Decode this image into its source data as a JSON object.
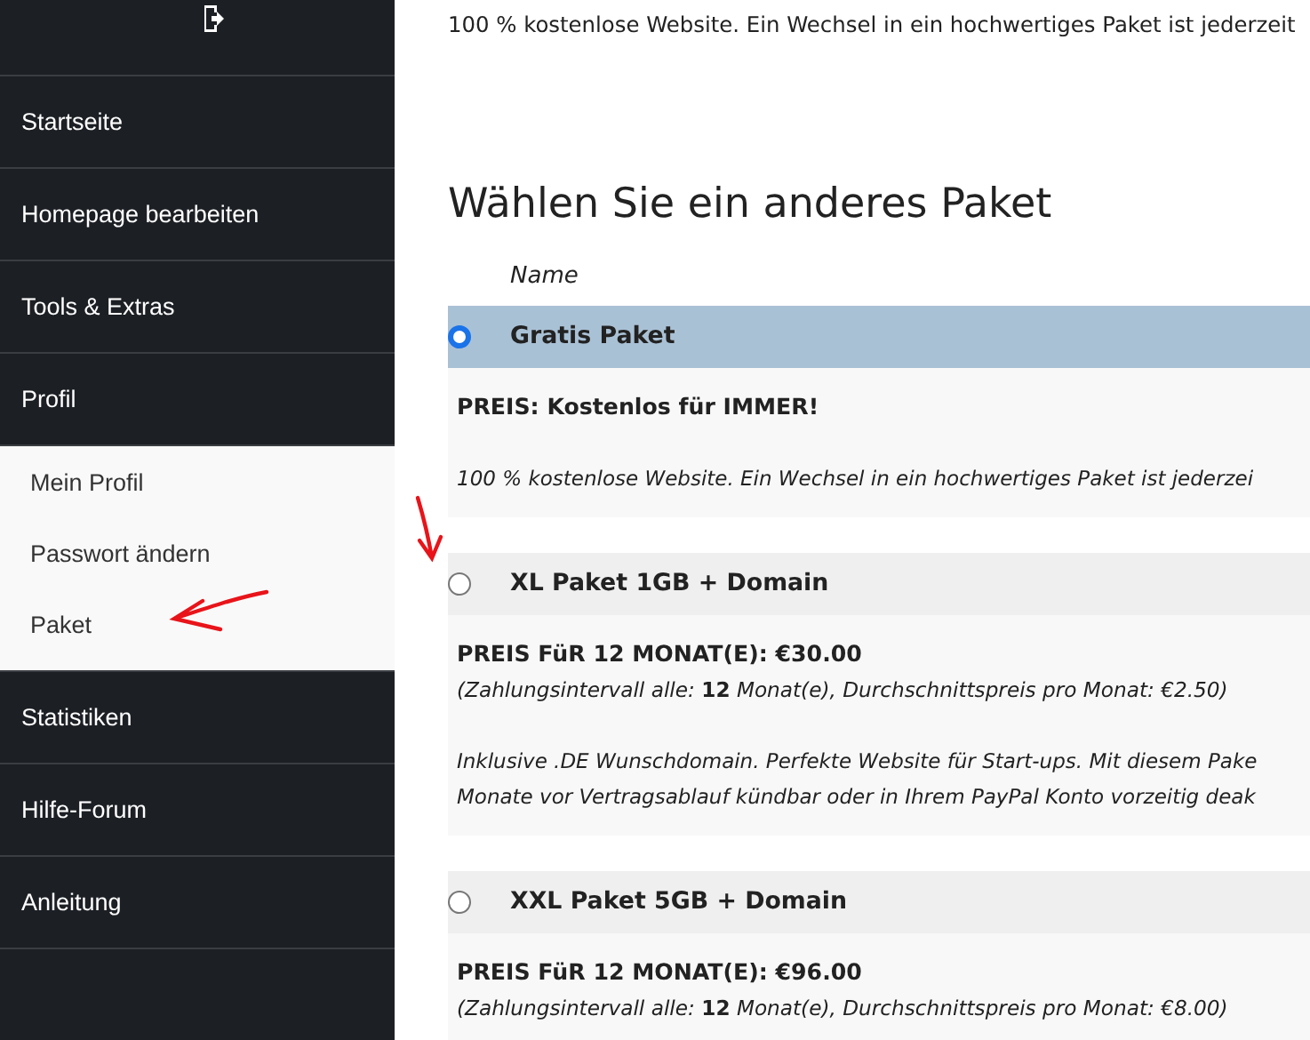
{
  "sidebar": {
    "items": [
      {
        "label": "Startseite"
      },
      {
        "label": "Homepage bearbeiten"
      },
      {
        "label": "Tools & Extras"
      },
      {
        "label": "Profil",
        "expanded": true,
        "children": [
          {
            "label": "Mein Profil"
          },
          {
            "label": "Passwort ändern"
          },
          {
            "label": "Paket"
          }
        ]
      },
      {
        "label": "Statistiken"
      },
      {
        "label": "Hilfe-Forum"
      },
      {
        "label": "Anleitung"
      }
    ]
  },
  "intro_text": "100 % kostenlose Website. Ein Wechsel in ein hochwertiges Paket ist jederzeit",
  "heading": "Wählen Sie ein anderes Paket",
  "table": {
    "column_header": "Name"
  },
  "packages": [
    {
      "name": "Gratis Paket",
      "selected": true,
      "price": "PREIS: Kostenlos für IMMER!",
      "description_lines": [
        "100 % kostenlose Website. Ein Wechsel in ein hochwertiges Paket ist jederzei"
      ]
    },
    {
      "name": "XL Paket 1GB + Domain",
      "selected": false,
      "price": "PREIS FüR 12 MONAT(E): €30.00",
      "interval": "(Zahlungsintervall alle: **12** Monat(e), Durchschnittspreis pro Monat: €2.50)",
      "description_lines": [
        "Inklusive .DE Wunschdomain. Perfekte Website für Start-ups. Mit diesem Pake",
        "Monate vor Vertragsablauf kündbar oder in Ihrem PayPal Konto vorzeitig deak"
      ]
    },
    {
      "name": "XXL Paket 5GB + Domain",
      "selected": false,
      "price": "PREIS FüR 12 MONAT(E): €96.00",
      "interval": "(Zahlungsintervall alle: **12** Monat(e), Durchschnittspreis pro Monat: €8.00)"
    }
  ]
}
